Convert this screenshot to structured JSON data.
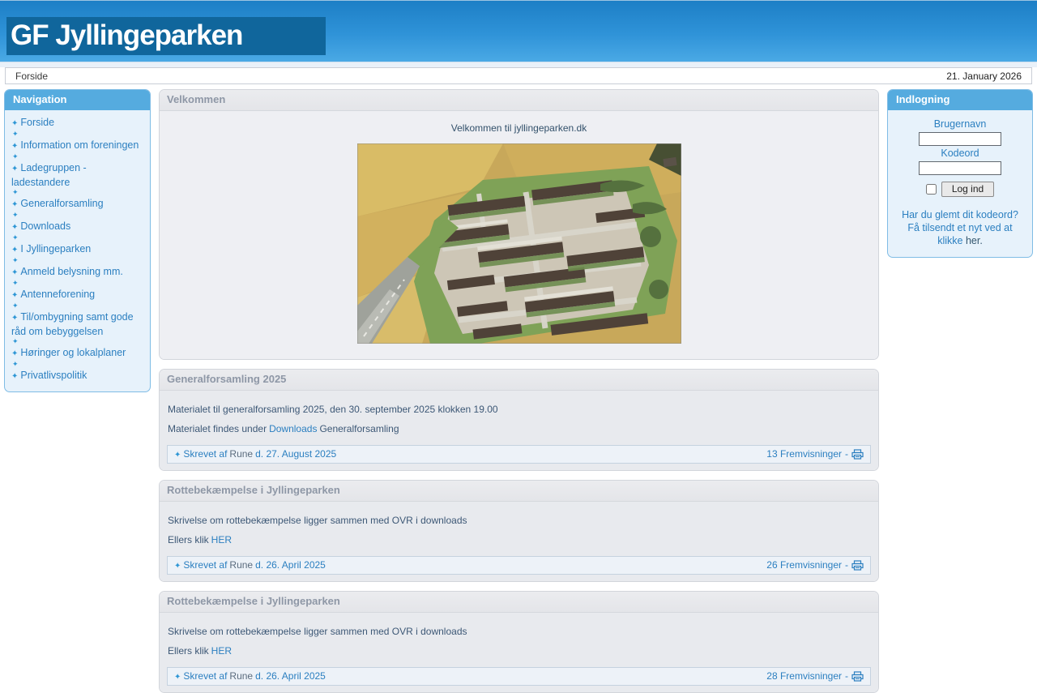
{
  "icons": {
    "bullet": "✦",
    "dash": "-"
  },
  "header": {
    "logo": "GF Jyllingeparken"
  },
  "topbar": {
    "breadcrumb": "Forside",
    "date": "21. January 2026"
  },
  "navigation": {
    "title": "Navigation",
    "items": [
      {
        "label": "Forside"
      },
      {
        "label": "Information om foreningen"
      },
      {
        "label": "Ladegruppen - ladestandere"
      },
      {
        "label": "Generalforsamling"
      },
      {
        "label": "Downloads"
      },
      {
        "label": "I Jyllingeparken"
      },
      {
        "label": "Anmeld belysning mm."
      },
      {
        "label": "Antenneforening"
      },
      {
        "label": "Til/ombygning samt gode råd om bebyggelsen"
      },
      {
        "label": "Høringer og lokalplaner"
      },
      {
        "label": "Privatlivspolitik"
      }
    ]
  },
  "login": {
    "title": "Indlogning",
    "username_label": "Brugernavn",
    "password_label": "Kodeord",
    "username_value": "",
    "password_value": "",
    "button_label": "Log ind",
    "forgot_line1": "Har du glemt dit kodeord?",
    "forgot_line2_prefix": "Få tilsendt et nyt ved at klikke",
    "forgot_line2_link": "her."
  },
  "welcome": {
    "title": "Velkommen",
    "text": "Velkommen til jyllingeparken.dk"
  },
  "news": [
    {
      "title": "Generalforsamling 2025",
      "line1": "Materialet til generalforsamling 2025, den 30. september 2025 klokken 19.00",
      "line2_prefix": "Materialet findes under",
      "line2_link": "Downloads",
      "line2_suffix": "Generalforsamling",
      "byline_prefix": "Skrevet af",
      "author": "Rune",
      "byline_date": "d. 27. August 2025",
      "views": "13 Fremvisninger"
    },
    {
      "title": "Rottebekæmpelse i Jyllingeparken",
      "line1": "Skrivelse om rottebekæmpelse ligger sammen med OVR i downloads",
      "line2_prefix": "Ellers klik",
      "line2_link": "HER",
      "byline_prefix": "Skrevet af",
      "author": "Rune",
      "byline_date": "d. 26. April 2025",
      "views": "26 Fremvisninger"
    },
    {
      "title": "Rottebekæmpelse i Jyllingeparken",
      "line1": "Skrivelse om rottebekæmpelse ligger sammen med OVR i downloads",
      "line2_prefix": "Ellers klik",
      "line2_link": "HER",
      "byline_prefix": "Skrevet af",
      "author": "Rune",
      "byline_date": "d. 26. April 2025",
      "views": "28 Fremvisninger"
    }
  ]
}
